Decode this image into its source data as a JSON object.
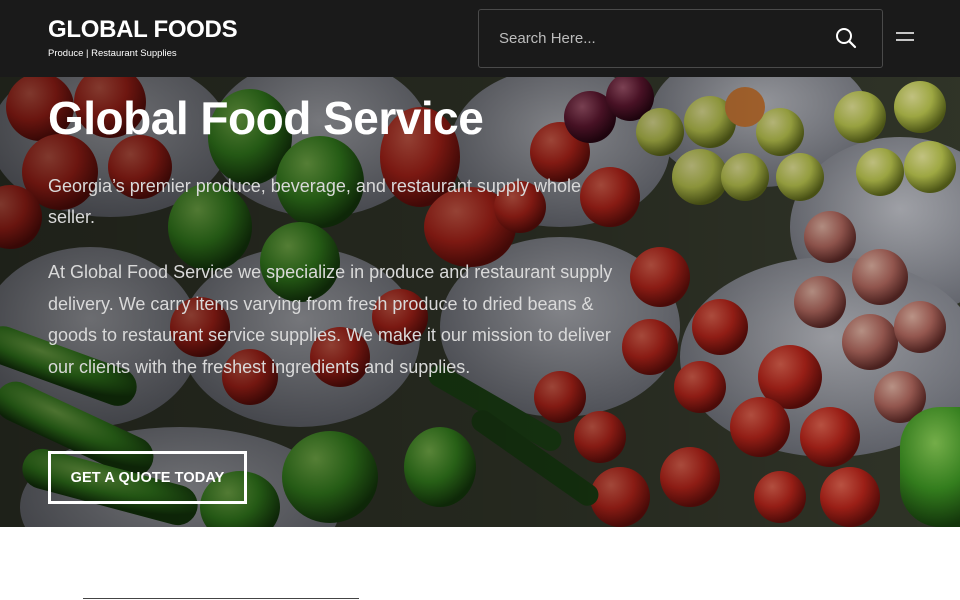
{
  "header": {
    "brand_name": "GLOBAL FOODS",
    "brand_tagline": "Produce | Restaurant Supplies",
    "search_placeholder": "Search Here..."
  },
  "hero": {
    "title": "Global Food Service",
    "subtitle": "Georgia’s premier produce, beverage, and restaurant supply whole seller.",
    "body": "At Global Food Service we specialize in produce and restaurant supply delivery. We carry items varying from fresh produce to dried beans & goods to restaurant service supplies. We make it our mission to deliver our clients with the freshest ingredients and supplies.",
    "cta_label": "GET A QUOTE TODAY"
  },
  "icons": {
    "search": "search-icon",
    "menu": "hamburger-menu-icon"
  },
  "colors": {
    "header_bg": "#1a1a1a",
    "text_light": "#ffffff",
    "text_muted": "#d9d9d9"
  }
}
